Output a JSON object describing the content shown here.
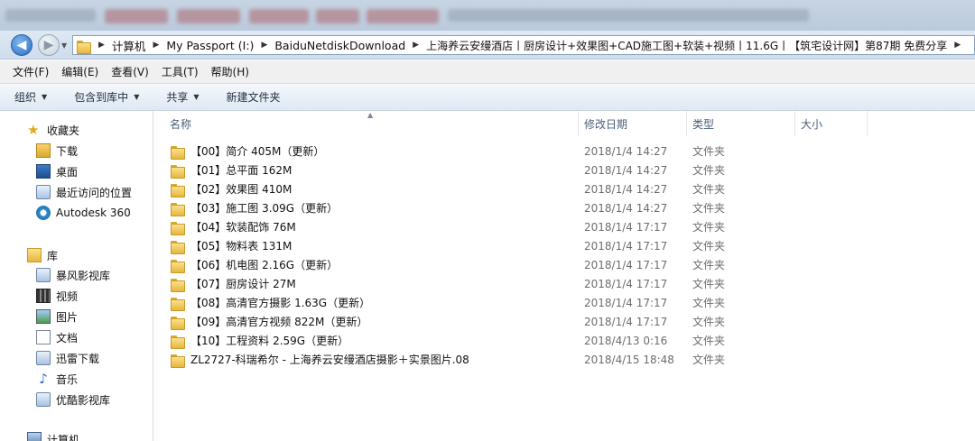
{
  "address": {
    "back_label": "◀",
    "forward_label": "▶",
    "crumbs": [
      "计算机",
      "My Passport (I:)",
      "BaiduNetdiskDownload",
      "上海养云安缦酒店丨厨房设计+效果图+CAD施工图+软装+视频丨11.6G丨【筑宅设计网】第87期 免费分享"
    ]
  },
  "menu": [
    "文件(F)",
    "编辑(E)",
    "查看(V)",
    "工具(T)",
    "帮助(H)"
  ],
  "toolbar": {
    "organize": "组织",
    "include_library": "包含到库中",
    "share": "共享",
    "new_folder": "新建文件夹"
  },
  "nav": {
    "favorites": "收藏夹",
    "downloads": "下载",
    "desktop": "桌面",
    "recent": "最近访问的位置",
    "autodesk": "Autodesk 360",
    "libraries": "库",
    "baofeng": "暴风影视库",
    "videos": "视频",
    "pictures": "图片",
    "documents": "文档",
    "xunlei": "迅雷下载",
    "music": "音乐",
    "youku": "优酷影视库",
    "computer": "计算机"
  },
  "columns": {
    "name": "名称",
    "date": "修改日期",
    "type": "类型",
    "size": "大小"
  },
  "files": [
    {
      "name": "【00】简介 405M（更新）",
      "date": "2018/1/4 14:27",
      "type": "文件夹"
    },
    {
      "name": "【01】总平面 162M",
      "date": "2018/1/4 14:27",
      "type": "文件夹"
    },
    {
      "name": "【02】效果图 410M",
      "date": "2018/1/4 14:27",
      "type": "文件夹"
    },
    {
      "name": "【03】施工图 3.09G（更新）",
      "date": "2018/1/4 14:27",
      "type": "文件夹"
    },
    {
      "name": "【04】软装配饰 76M",
      "date": "2018/1/4 17:17",
      "type": "文件夹"
    },
    {
      "name": "【05】物料表 131M",
      "date": "2018/1/4 17:17",
      "type": "文件夹"
    },
    {
      "name": "【06】机电图 2.16G（更新）",
      "date": "2018/1/4 17:17",
      "type": "文件夹"
    },
    {
      "name": "【07】厨房设计 27M",
      "date": "2018/1/4 17:17",
      "type": "文件夹"
    },
    {
      "name": "【08】高清官方摄影 1.63G（更新）",
      "date": "2018/1/4 17:17",
      "type": "文件夹"
    },
    {
      "name": "【09】高清官方视频 822M（更新）",
      "date": "2018/1/4 17:17",
      "type": "文件夹"
    },
    {
      "name": "【10】工程资料 2.59G（更新）",
      "date": "2018/4/13 0:16",
      "type": "文件夹"
    },
    {
      "name": "ZL2727-科瑞希尔 - 上海养云安缦酒店摄影＋实景图片.08",
      "date": "2018/4/15 18:48",
      "type": "文件夹"
    }
  ]
}
